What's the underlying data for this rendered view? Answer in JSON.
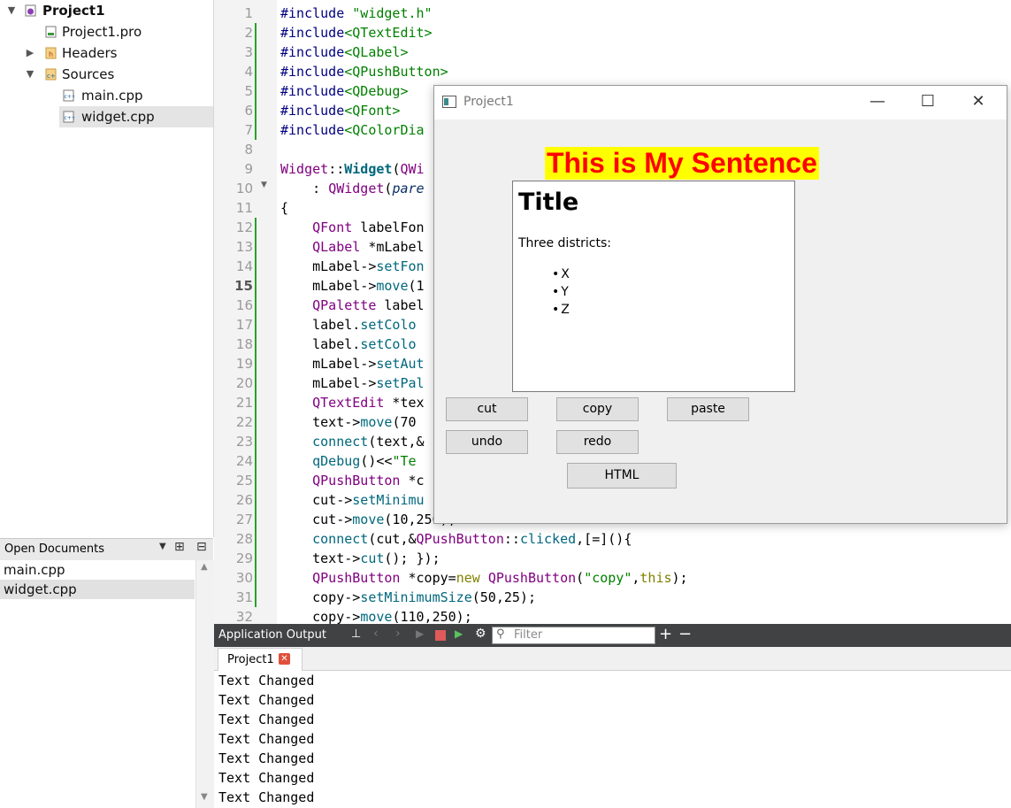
{
  "project_tree": {
    "project": "Project1",
    "pro_file": "Project1.pro",
    "headers": "Headers",
    "sources": "Sources",
    "files": [
      "main.cpp",
      "widget.cpp"
    ]
  },
  "open_documents": {
    "title": "Open Documents",
    "docs": [
      "main.cpp",
      "widget.cpp"
    ]
  },
  "editor": {
    "current_line": 15,
    "line_numbers": [
      "1",
      "2",
      "3",
      "4",
      "5",
      "6",
      "7",
      "8",
      "9",
      "10",
      "11",
      "12",
      "13",
      "14",
      "15",
      "16",
      "17",
      "18",
      "19",
      "20",
      "21",
      "22",
      "23",
      "24",
      "25",
      "26",
      "27",
      "28",
      "29",
      "30",
      "31",
      "32"
    ]
  },
  "app_output": {
    "title": "Application Output",
    "filter_placeholder": "Filter",
    "tab": "Project1",
    "lines": [
      "Text Changed",
      "Text Changed",
      "Text Changed",
      "Text Changed",
      "Text Changed",
      "Text Changed",
      "Text Changed"
    ]
  },
  "window": {
    "title": "Project1",
    "sentence": "This is My Sentence",
    "sentence_color": "#ff0000",
    "sentence_bg": "#ffff00",
    "textedit": {
      "heading": "Title",
      "paragraph": "Three districts:",
      "items": [
        "X",
        "Y",
        "Z"
      ]
    },
    "buttons": {
      "cut": "cut",
      "copy": "copy",
      "paste": "paste",
      "undo": "undo",
      "redo": "redo",
      "html": "HTML"
    }
  }
}
